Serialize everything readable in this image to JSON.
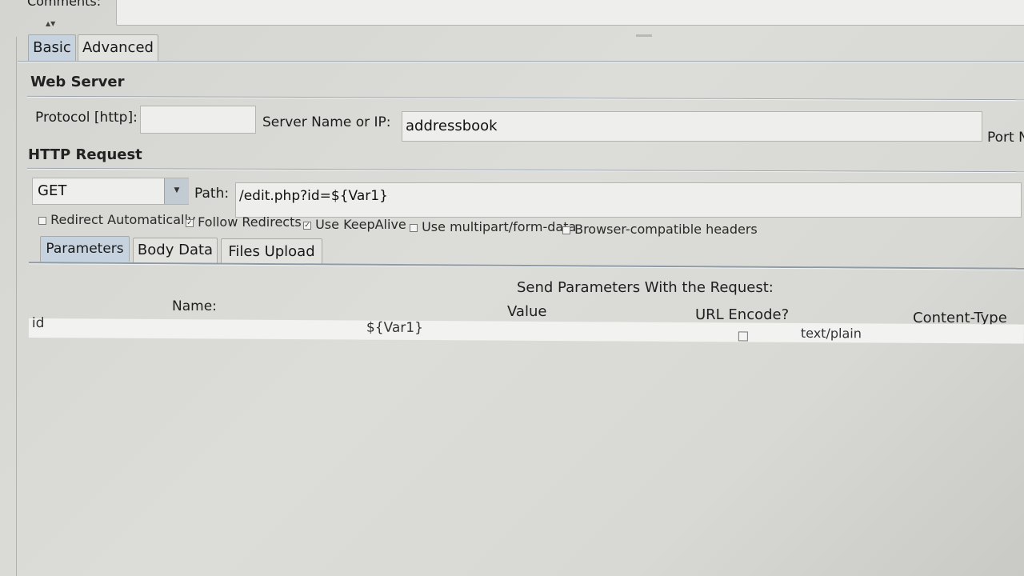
{
  "comments": {
    "label": "Comments:"
  },
  "tabs": [
    {
      "label": "Basic",
      "active": true
    },
    {
      "label": "Advanced",
      "active": false
    }
  ],
  "web_server": {
    "title": "Web Server",
    "protocol_label": "Protocol [http]:",
    "protocol_value": "",
    "server_label": "Server Name or IP:",
    "server_value": "addressbook",
    "port_label": "Port N"
  },
  "http_request": {
    "title": "HTTP Request",
    "method": "GET",
    "path_label": "Path:",
    "path_value": "/edit.php?id=${Var1}",
    "options": [
      {
        "label": "Redirect Automatically",
        "checked": false
      },
      {
        "label": "Follow Redirects",
        "checked": true
      },
      {
        "label": "Use KeepAlive",
        "checked": true
      },
      {
        "label": "Use multipart/form-data",
        "checked": false
      },
      {
        "label": "Browser-compatible headers",
        "checked": false
      }
    ]
  },
  "subtabs": [
    {
      "label": "Parameters",
      "active": true
    },
    {
      "label": "Body Data",
      "active": false
    },
    {
      "label": "Files Upload",
      "active": false
    }
  ],
  "parameters": {
    "title": "Send Parameters With the Request:",
    "columns": [
      "Name:",
      "Value",
      "URL Encode?",
      "Content-Type"
    ],
    "rows": [
      {
        "name": "id",
        "value": "${Var1}",
        "url_encode": false,
        "content_type": "text/plain"
      }
    ]
  }
}
